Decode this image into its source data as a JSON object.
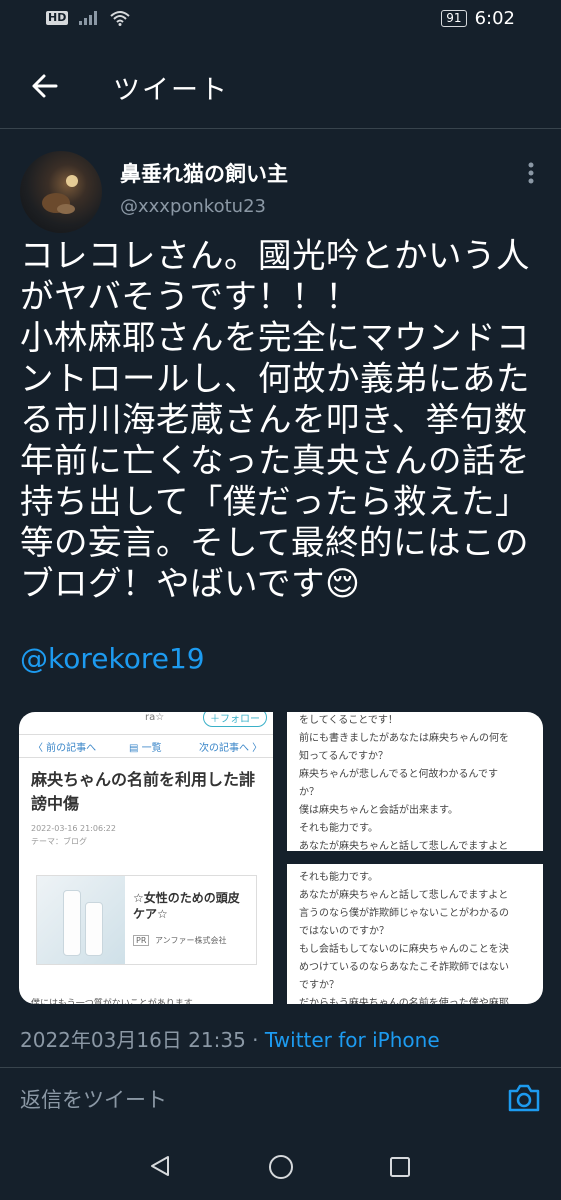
{
  "status_bar": {
    "hd_label": "HD",
    "battery": "91",
    "time": "6:02"
  },
  "header": {
    "title": "ツイート"
  },
  "author": {
    "name": "鼻垂れ猫の飼い主",
    "handle": "@xxxponkotu23"
  },
  "tweet": {
    "text": "コレコレさん。國光吟とかいう人\nがヤバそうです！！！\n小林麻耶さんを完全にマウンドコ\nントロールし、何故か義弟にあた\nる市川海老蔵さんを叩き、挙句数\n年前に亡くなった真央さんの話を\n持ち出して「僕だったら救えた」\n等の妄言。そして最終的にはこの\nブログ！やばいです😌",
    "mention": "@korekore19"
  },
  "media": {
    "left": {
      "top_fragment": "ra☆",
      "follow_label": "＋フォロー",
      "nav_prev": "〈  前の記事へ",
      "nav_list": "▤ 一覧",
      "nav_next": "次の記事へ  〉",
      "title": "麻央ちゃんの名前を利用した誹謗中傷",
      "date": "2022-03-16 21:06:22",
      "theme": "テーマ：ブログ",
      "ad_title": "☆女性のための頭皮ケア☆",
      "ad_pr": "PR",
      "ad_company": "アンファー株式会社",
      "bottom_fragment": "僕にはもう一つ質がないことがあります"
    },
    "right_top_lines": [
      "をしてくることです！",
      "前にも書きましたがあなたは麻央ちゃんの何を",
      "知ってるんですか？",
      "麻央ちゃんが悲しんでると何故わかるんです",
      "か？",
      "僕は麻央ちゃんと会話が出来ます。",
      "それも能力です。",
      "あなたが麻央ちゃんと話して悲しんでますよと"
    ],
    "right_bottom_lines": [
      "それも能力です。",
      "あなたが麻央ちゃんと話して悲しんでますよと",
      "言うのなら僕が詐欺師じゃないことがわかるの",
      "ではないのですか？",
      "もし会話もしてないのに麻央ちゃんのことを決",
      "めつけているのならあなたこそ詐欺師ではない",
      "ですか？",
      "だからもう麻央ちゃんの名前を使った僕や麻耶"
    ]
  },
  "meta": {
    "timestamp": "2022年03月16日 21:35",
    "separator": " · ",
    "source": "Twitter for iPhone"
  },
  "reply": {
    "placeholder": "返信をツイート"
  },
  "colors": {
    "background": "#15202b",
    "accent": "#1d9bf0",
    "muted_text": "#8b98a5",
    "divider": "#38444d"
  }
}
